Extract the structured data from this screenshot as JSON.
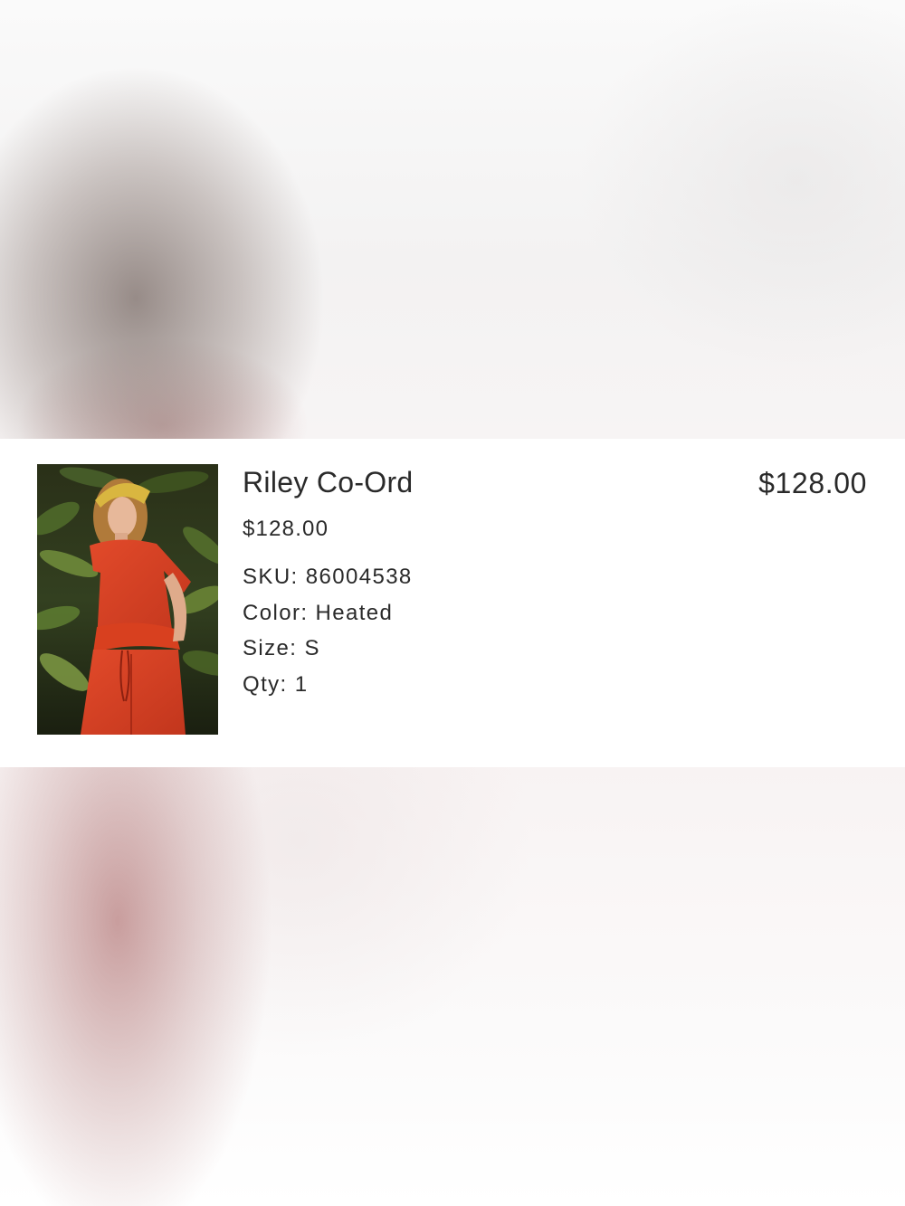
{
  "order_item": {
    "name": "Riley Co-Ord",
    "unit_price": "$128.00",
    "total_price": "$128.00",
    "image_alt": "Riley Co-Ord product photo",
    "attributes": [
      {
        "label": "SKU:",
        "value": "86004538"
      },
      {
        "label": "Color:",
        "value": "Heated"
      },
      {
        "label": "Size:",
        "value": "S"
      },
      {
        "label": "Qty:",
        "value": "1"
      }
    ]
  }
}
